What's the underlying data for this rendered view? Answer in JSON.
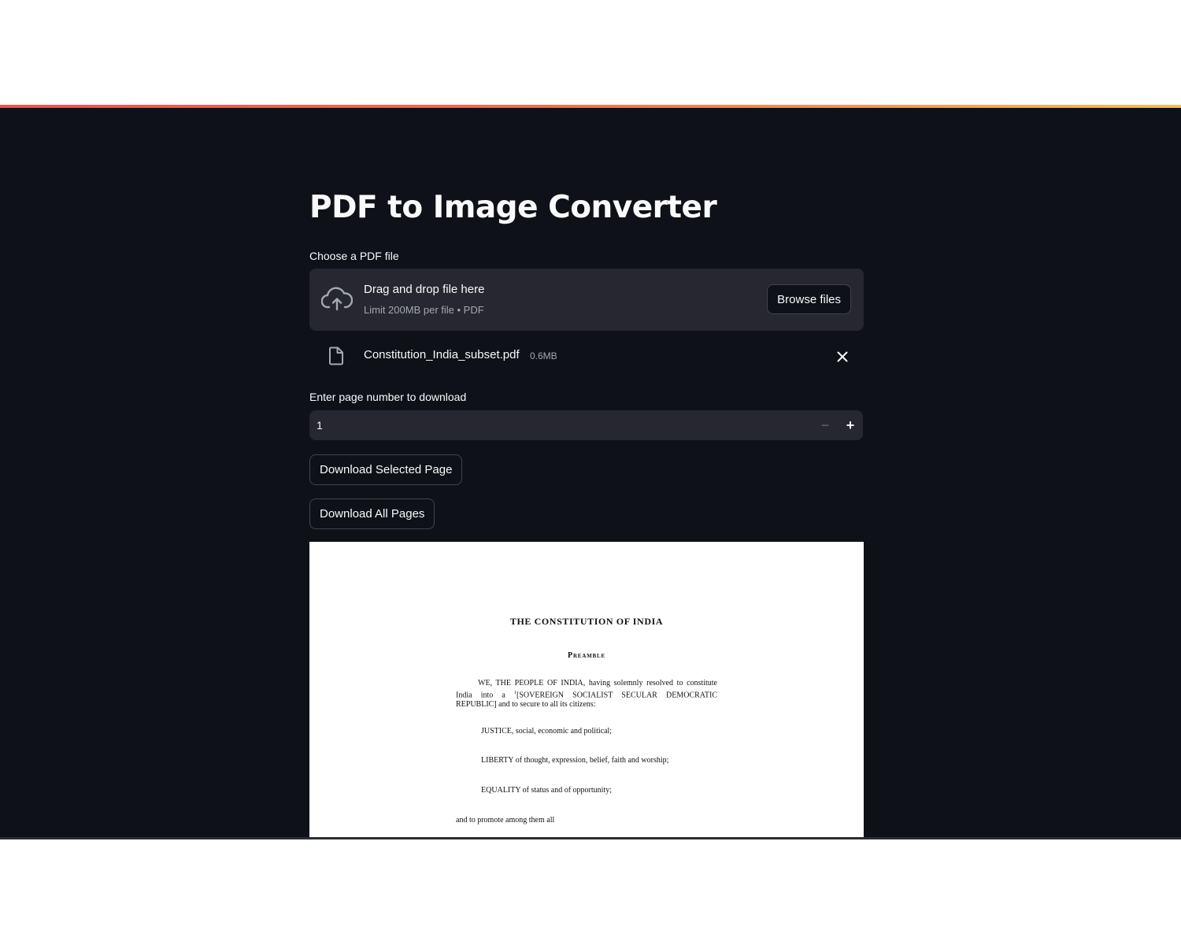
{
  "app": {
    "title": "PDF to Image Converter"
  },
  "uploader": {
    "label": "Choose a PDF file",
    "drop_text": "Drag and drop file here",
    "limit_text": "Limit 200MB per file • PDF",
    "browse_label": "Browse files",
    "file": {
      "name": "Constitution_India_subset.pdf",
      "size": "0.6MB"
    }
  },
  "page_input": {
    "label": "Enter page number to download",
    "value": "1",
    "minus_symbol": "−",
    "plus_symbol": "+"
  },
  "buttons": {
    "download_selected": "Download Selected Page",
    "download_all": "Download All Pages"
  },
  "preview": {
    "heading": "THE CONSTITUTION OF INDIA",
    "subheading": "Preamble",
    "para_part1": "WE, THE PEOPLE OF INDIA, having solemnly resolved to constitute India into a ",
    "para_footnote": "1",
    "para_part2": "[SOVEREIGN SOCIALIST SECULAR DEMOCRATIC REPUBLIC] and to secure to all its citizens:",
    "justice": "JUSTICE, social, economic and political;",
    "liberty": "LIBERTY of thought, expression, belief, faith and worship;",
    "equality": "EQUALITY of status and of opportunity;",
    "promote": "and to promote among them all"
  },
  "colors": {
    "background": "#0e1117",
    "widget": "#262730",
    "text": "#fafafa",
    "muted": "#a3a8b4",
    "accent_start": "#ff4b4b",
    "accent_end": "#ffbd45"
  },
  "icons": {
    "upload": "cloud-upload-icon",
    "file": "file-icon",
    "close": "close-icon"
  }
}
